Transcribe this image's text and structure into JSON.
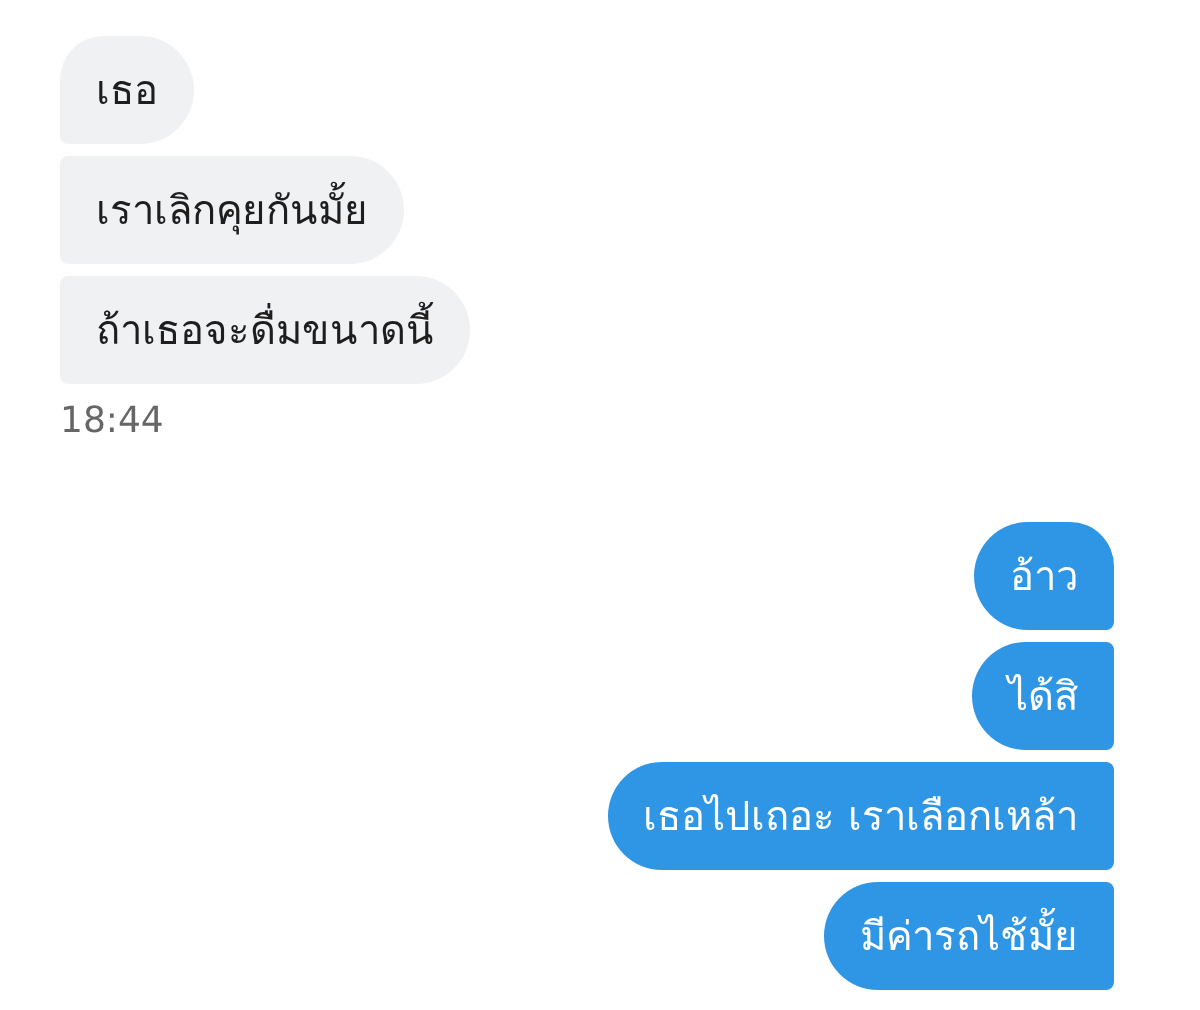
{
  "groups": [
    {
      "kind": "received",
      "messages": [
        "เธอ",
        "เราเลิกคุยกันมั้ย",
        "ถ้าเธอจะดื่มขนาดนี้"
      ],
      "time": "18:44"
    },
    {
      "kind": "sent",
      "messages": [
        "อ้าว",
        "ได้สิ",
        "เธอไปเถอะ เราเลือกเหล้า",
        "มีค่ารถไช้มั้ย"
      ]
    }
  ]
}
